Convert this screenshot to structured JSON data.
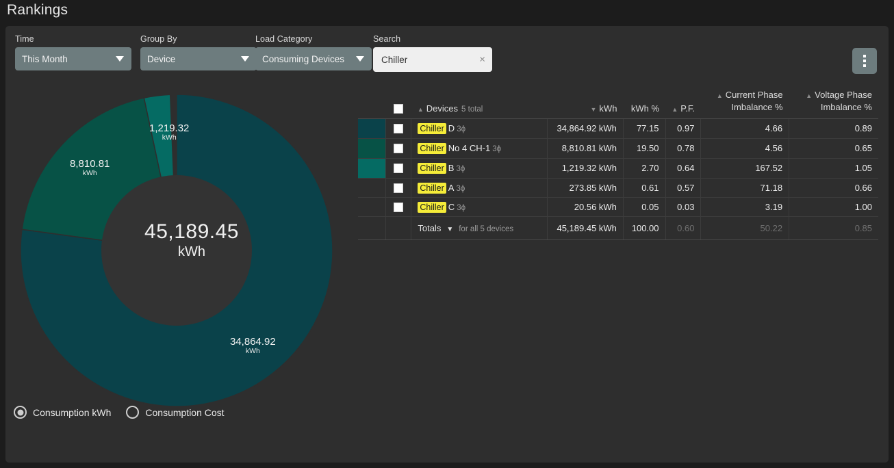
{
  "app": {
    "title": "Rankings"
  },
  "colors": {
    "slice_0": "#0a424a",
    "slice_1": "#075246",
    "slice_2": "#056b63",
    "accent_tag": "#f5ec39",
    "control_bg": "#6d7c7e",
    "card_bg": "#2e2e2e"
  },
  "filters": {
    "time": {
      "label": "Time",
      "value": "This Month"
    },
    "group": {
      "label": "Group By",
      "value": "Device"
    },
    "load": {
      "label": "Load Category",
      "value": "Consuming Devices"
    },
    "search": {
      "label": "Search",
      "value": "Chiller",
      "placeholder": "Search",
      "clear": "×"
    }
  },
  "menu_button": {
    "name": "more-options"
  },
  "chart_data": {
    "type": "pie",
    "title": "",
    "center_value": "45,189.45",
    "center_unit": "kWh",
    "unit": "kWh",
    "categories": [
      "Chiller D",
      "Chiller No 4 CH-1",
      "Chiller B",
      "Chiller A",
      "Chiller C"
    ],
    "values": [
      34864.92,
      8810.81,
      1219.32,
      273.85,
      20.56
    ],
    "percents": [
      77.15,
      19.5,
      2.7,
      0.61,
      0.05
    ],
    "colors": [
      "#0a424a",
      "#075246",
      "#056b63",
      null,
      null
    ],
    "labels": [
      {
        "value": "34,864.92",
        "unit": "kWh"
      },
      {
        "value": "8,810.81",
        "unit": "kWh"
      },
      {
        "value": "1,219.32",
        "unit": "kWh"
      }
    ],
    "legend": "none",
    "total": 45189.45
  },
  "mode_radios": {
    "options": [
      {
        "label": "Consumption kWh",
        "selected": true
      },
      {
        "label": "Consumption Cost",
        "selected": false
      }
    ]
  },
  "table": {
    "headers": {
      "devices": "Devices",
      "devices_count": "5 total",
      "kwh": "kWh",
      "kwh_pct": "kWh %",
      "pf": "P.F.",
      "current_phase_l1": "Current Phase",
      "current_phase_l2": "Imbalance %",
      "voltage_phase_l1": "Voltage Phase",
      "voltage_phase_l2": "Imbalance %"
    },
    "rows": [
      {
        "swatch": "#0a424a",
        "tag": "Chiller",
        "name": "D",
        "phase": "3ϕ",
        "kwh": "34,864.92 kWh",
        "kwh_pct": "77.15",
        "pf": "0.97",
        "current": "4.66",
        "voltage": "0.89"
      },
      {
        "swatch": "#075246",
        "tag": "Chiller",
        "name": "No 4 CH-1",
        "phase": "3ϕ",
        "kwh": "8,810.81 kWh",
        "kwh_pct": "19.50",
        "pf": "0.78",
        "current": "4.56",
        "voltage": "0.65"
      },
      {
        "swatch": "#056b63",
        "tag": "Chiller",
        "name": "B",
        "phase": "3ϕ",
        "kwh": "1,219.32 kWh",
        "kwh_pct": "2.70",
        "pf": "0.64",
        "current": "167.52",
        "voltage": "1.05"
      },
      {
        "swatch": "",
        "tag": "Chiller",
        "name": "A",
        "phase": "3ϕ",
        "kwh": "273.85 kWh",
        "kwh_pct": "0.61",
        "pf": "0.57",
        "current": "71.18",
        "voltage": "0.66"
      },
      {
        "swatch": "",
        "tag": "Chiller",
        "name": "C",
        "phase": "3ϕ",
        "kwh": "20.56 kWh",
        "kwh_pct": "0.05",
        "pf": "0.03",
        "current": "3.19",
        "voltage": "1.00"
      }
    ],
    "totals": {
      "label": "Totals",
      "sub": "for all 5 devices",
      "kwh": "45,189.45 kWh",
      "kwh_pct": "100.00",
      "pf": "0.60",
      "current": "50.22",
      "voltage": "0.85"
    }
  }
}
